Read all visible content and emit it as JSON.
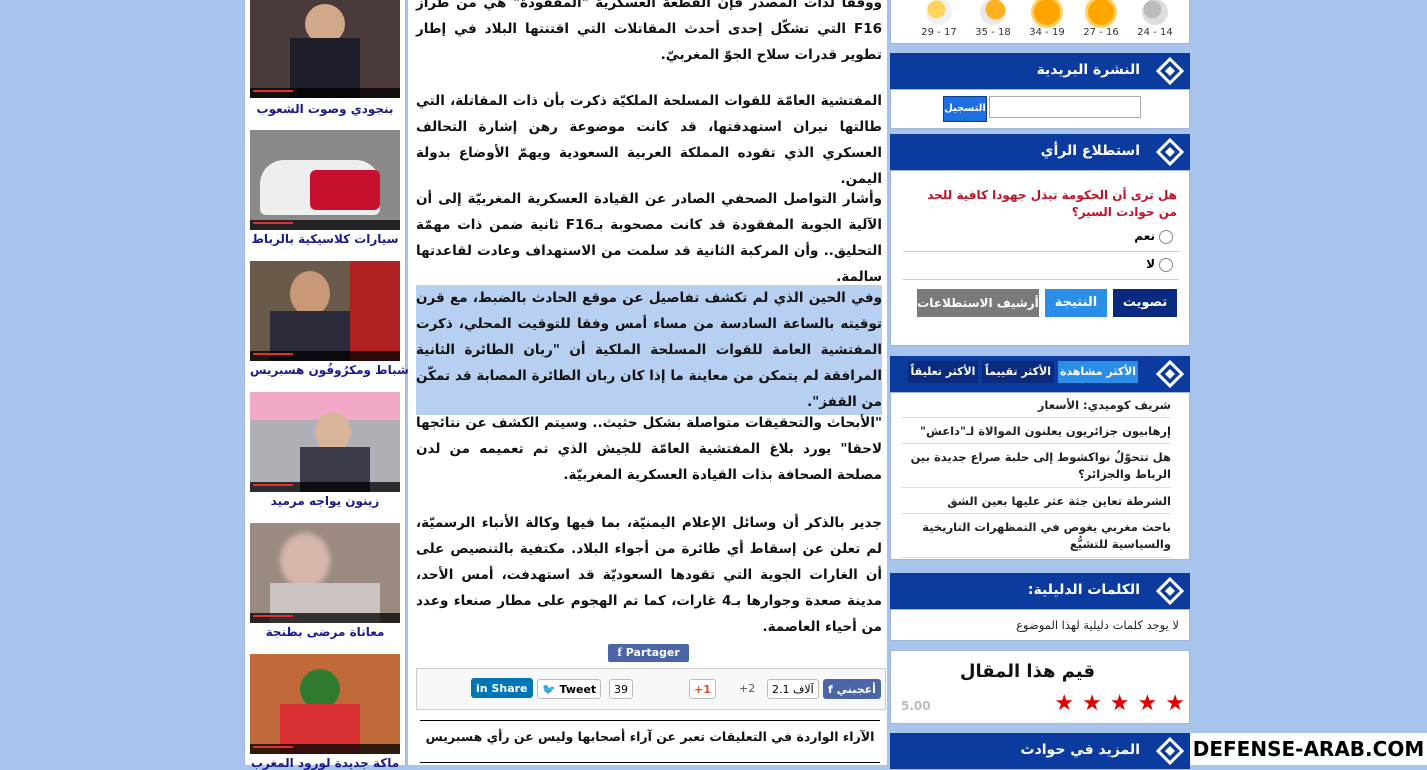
{
  "videos": [
    {
      "caption": "بنجودي وصوت الشعوب",
      "bg": "#4a3a3a"
    },
    {
      "caption": "سيارات كلاسيكية بالرباط",
      "bg": "#8a8a8a"
    },
    {
      "caption": "شباط ومكرُوفُون هسبريس",
      "bg": "#6a5a4a"
    },
    {
      "caption": "زينون يواجه مرميد",
      "bg": "#aeb0b6"
    },
    {
      "caption": "معاناة مرضى بطنجة",
      "bg": "#9a8a80"
    },
    {
      "caption": "ماكة جديدة لورود المغرب",
      "bg": "#c06a3a"
    }
  ],
  "article": {
    "p0": "ووفقا لذات المصدر فإن القطعة العسكرية \"المفقودة\" هي من طراز F16 التي تشكّل إحدى أحدث المقاتلات التي اقتنتها البلاد في إطار تطوير قدرات سلاح الجوّ المغربيّ.",
    "p1": "المفتشية العامّة للقوات المسلحة الملكيّة ذكرت بأن ذات المقاتلة، التي طالتها نيران استهدفتها، قد كانت موضوعة رهن إشارة التحالف العسكري الذي تقوده المملكة العربية السعودية ويهمّ الأوضاع بدولة اليمن.",
    "p2": "وأشار التواصل الصحفي الصادر عن القيادة العسكرية المغربيّة إلى أن الآلية الجوية المفقودة قد كانت مصحوبة بـF16 ثانية ضمن ذات مهمّة التحليق.. وأن المركبة الثانية قد سلمت من الاستهداف وعادت لقاعدتها سالمة.",
    "p3": "وفي الحين الذي لم تكشف تفاصيل عن موقع الحادث بالضبط، مع قرن توقيته بالساعة السادسة من مساء أمس وفقا للتوقيت المحلي، ذكرت المفتشية العامة للقوات المسلحة الملكية أن \"ربان الطائرة الثانية المرافقة لم يتمكن من معاينة ما إذا كان ربان الطائرة المصابة قد تمكّن من القفز\".",
    "p4": "\"الأبحاث والتحقيقات متواصلة بشكل حثيث.. وسيتم الكشف عن نتائجها لاحقا\" يورد بلاغ المفتشية العامّة للجيش الذي تم تعميمه من لدن مصلحة الصحافة بذات القيادة العسكرية المغربيّة.",
    "p5": "جدير بالذكر أن وسائل الإعلام اليمنيّة، بما فيها وكالة الأنباء الرسميّة، لم تعلن عن إسقاط أي طائرة من أجواء البلاد. مكتفية بالتنصيص على أن الغارات الجوية التي تقودها السعوديّة قد استهدفت، أمس الأحد، مدينة صعدة وجوارها بـ4 غارات، كما تم الهجوم على مطار صنعاء وعدد من أحياء العاصمة."
  },
  "share": {
    "partager": "Partager",
    "linkedin": "Share",
    "tweet": "Tweet",
    "tweet_count": "39",
    "gplus": "+1",
    "gplus_count": "+2",
    "like": "أعجبني",
    "like_count": "2.1 آلاف",
    "disclaimer": "الآراء الواردة في التعليقات تعبر عن آراء أصحابها وليس عن رأي هسبريس"
  },
  "weather": [
    {
      "range": "29 - 17"
    },
    {
      "range": "35 - 18"
    },
    {
      "range": "34 - 19"
    },
    {
      "range": "27 - 16"
    },
    {
      "range": "24 - 14"
    }
  ],
  "newsletter": {
    "title": "النشرة البريدية",
    "button": "التسجيل",
    "value": ""
  },
  "poll": {
    "title": "استطلاع الرأي",
    "question": "هل ترى أن الحكومة تبذل جهودا كافية للحد من حوادث السير؟",
    "option_yes": "نعم",
    "option_no": "لا",
    "vote": "تصويت",
    "result": "النتيجة",
    "archive": "أرشيف الاستطلاعات"
  },
  "tabs": {
    "most_viewed": "الأكثر مشاهدة",
    "most_rated": "الأكثر تقييماً",
    "most_commented": "الأكثر تعليقاً"
  },
  "popular": [
    "شريف كوميدي: الأسعار",
    "إرهابيون جزائريون يعلنون الموالاة لـ\"داعش\"",
    "هل تتحوّلُ نواكشوط إلى حلبة صراع جديدة بين الرباط والجزائر؟",
    "الشرطة تعاين جثة عثر عليها بعين الشق",
    "باحث مغربي يغوص في التمظهرات التاريخية والسياسية للتشيُّع"
  ],
  "keywords": {
    "title": "الكلمات الدليلية:",
    "empty": "لا يوجد كلمات دليلية لهذا الموضوع"
  },
  "rating": {
    "title": "قيم هذا المقال",
    "score": "5.00",
    "stars": 5
  },
  "more": {
    "title": "المزيد في حوادث"
  },
  "watermark": "DEFENSE-ARAB.COM",
  "colors": {
    "header": "#0c3ba0",
    "accent": "#e00000",
    "highlight": "#b7cff0"
  }
}
